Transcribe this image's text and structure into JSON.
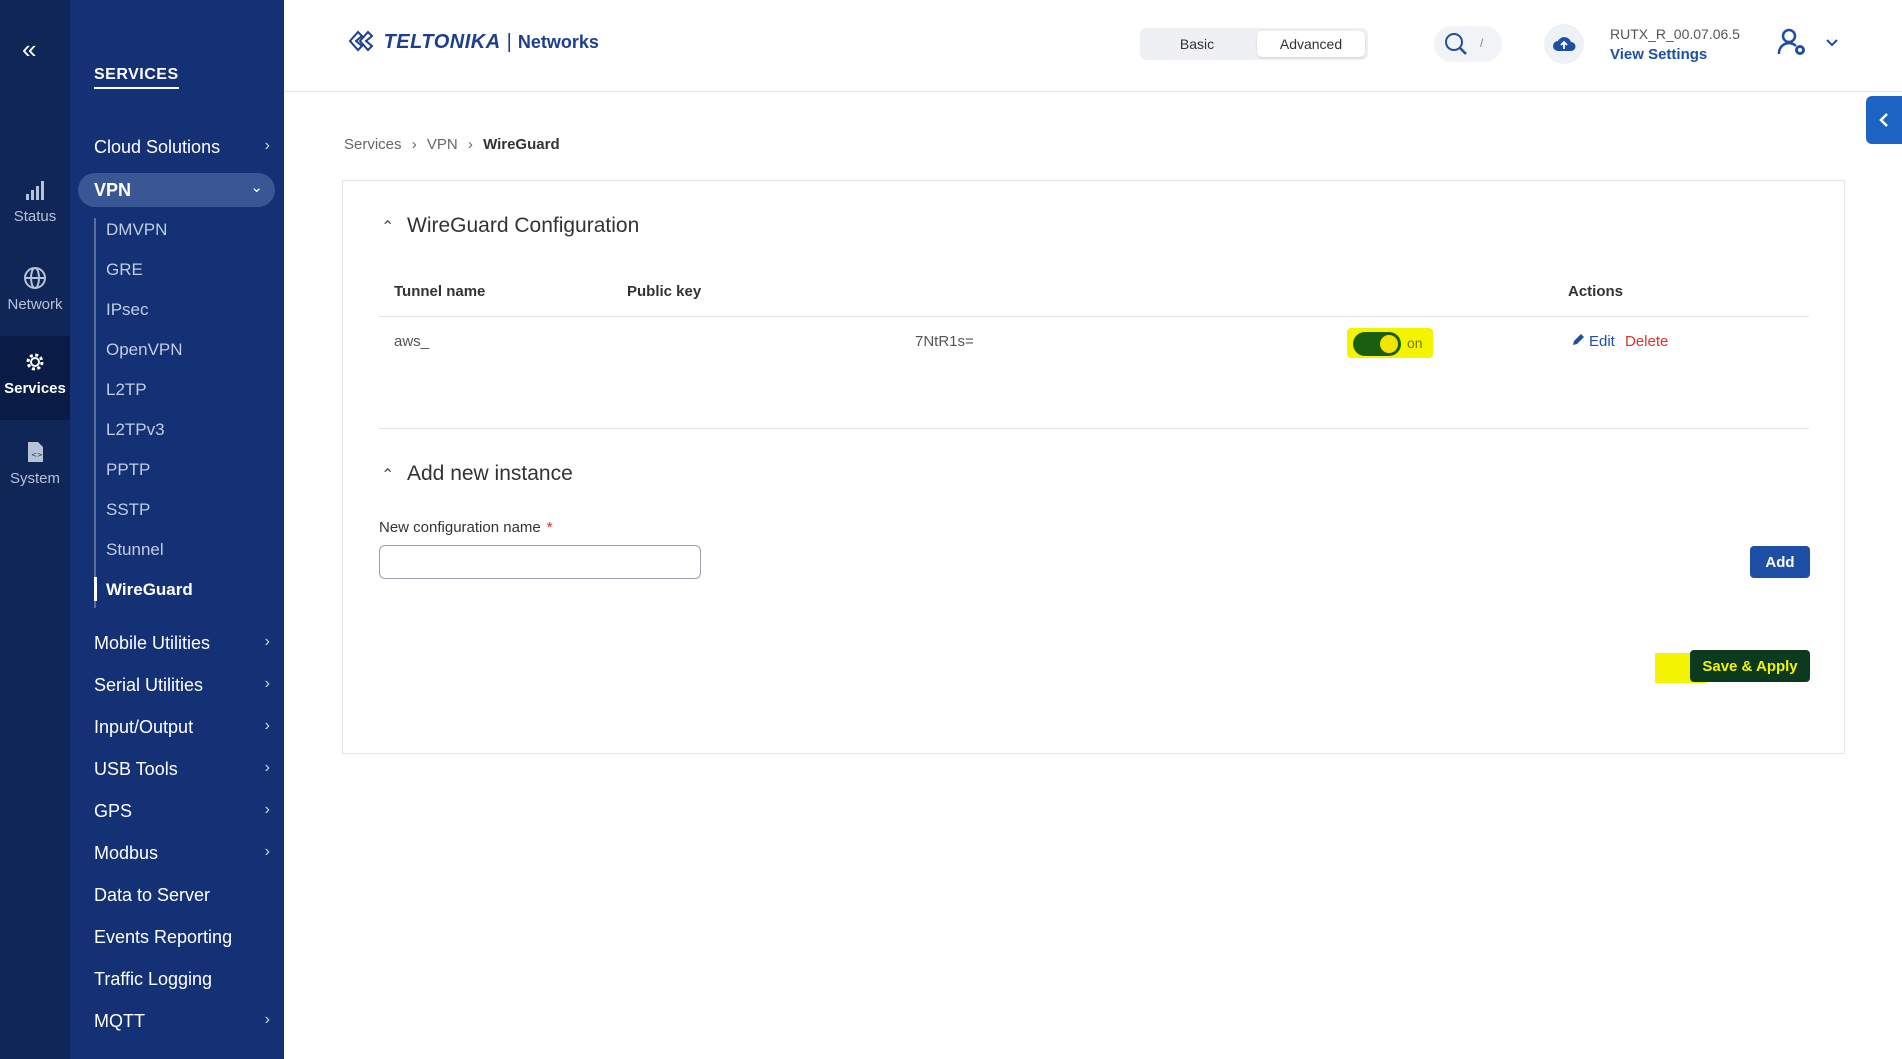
{
  "rail": {
    "items": [
      {
        "label": "Status",
        "icon": "signal-bars-icon"
      },
      {
        "label": "Network",
        "icon": "globe-icon"
      },
      {
        "label": "Services",
        "icon": "gear-icon"
      },
      {
        "label": "System",
        "icon": "document-code-icon"
      }
    ]
  },
  "menu": {
    "title": "SERVICES",
    "cloud_solutions": "Cloud Solutions",
    "vpn": "VPN",
    "vpn_sub": [
      "DMVPN",
      "GRE",
      "IPsec",
      "OpenVPN",
      "L2TP",
      "L2TPv3",
      "PPTP",
      "SSTP",
      "Stunnel",
      "WireGuard"
    ],
    "items_after": [
      "Mobile Utilities",
      "Serial Utilities",
      "Input/Output",
      "USB Tools",
      "GPS",
      "Modbus",
      "Data to Server",
      "Events Reporting",
      "Traffic Logging",
      "MQTT"
    ]
  },
  "header": {
    "brand": "TELTONIKA",
    "separator": "|",
    "networks": "Networks",
    "mode_basic": "Basic",
    "mode_advanced": "Advanced",
    "search_shortcut": "/",
    "firmware": "RUTX_R_00.07.06.5",
    "view_settings": "View Settings"
  },
  "breadcrumb": [
    "Services",
    "VPN",
    "WireGuard"
  ],
  "config": {
    "title": "WireGuard Configuration",
    "col_tunnel": "Tunnel name",
    "col_key": "Public key",
    "col_actions": "Actions",
    "row": {
      "tunnel_name": "aws_",
      "public_key": "7NtR1s=",
      "status": "on",
      "edit": "Edit",
      "delete": "Delete"
    }
  },
  "new_instance": {
    "title": "Add new instance",
    "field_label": "New configuration name",
    "required": "*",
    "field_value": "",
    "add": "Add"
  },
  "save_apply": "Save & Apply",
  "colors": {
    "rail_bg": "#0f2657",
    "menu_bg": "#133174",
    "accent": "#1d4fa5",
    "highlight": "#f4f400",
    "delete": "#d9342b"
  }
}
